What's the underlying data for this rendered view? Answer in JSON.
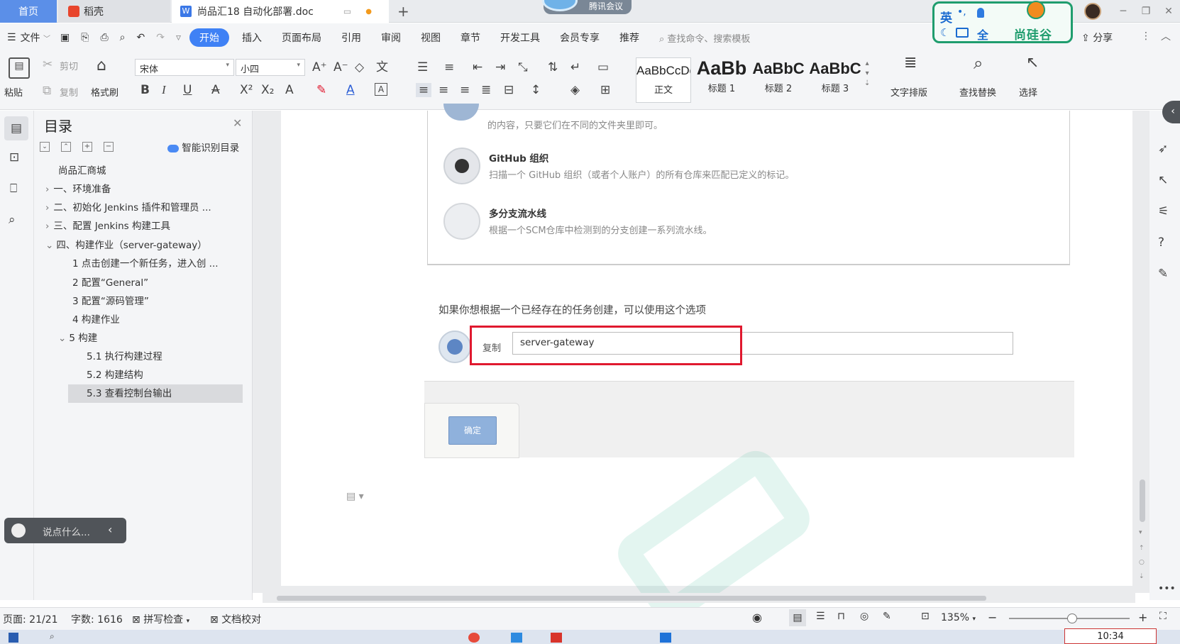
{
  "tabs": {
    "home": "首页",
    "daoke": "稻壳",
    "doc": "尚品汇18 自动化部署.doc",
    "meeting": "腾讯会议"
  },
  "ime": {
    "lang": "英",
    "full": "全",
    "brand": "尚硅谷"
  },
  "menu": {
    "file": "文件",
    "items": [
      "开始",
      "插入",
      "页面布局",
      "引用",
      "审阅",
      "视图",
      "章节",
      "开发工具",
      "会员专享",
      "推荐"
    ],
    "search_placeholder": "查找命令、搜索模板",
    "share": "分享"
  },
  "ribbon": {
    "paste": "粘贴",
    "cut": "剪切",
    "copy": "复制",
    "format_painter": "格式刷",
    "font_name": "宋体",
    "font_size": "小四",
    "styles": [
      {
        "sample": "AaBbCcDd",
        "label": "正文"
      },
      {
        "sample": "AaBb",
        "label": "标题 1"
      },
      {
        "sample": "AaBbC",
        "label": "标题 2"
      },
      {
        "sample": "AaBbC",
        "label": "标题 3"
      }
    ],
    "text_layout": "文字排版",
    "find_replace": "查找替换",
    "select": "选择"
  },
  "toc": {
    "title": "目录",
    "smart": "智能识别目录",
    "items": [
      "尚品汇商城",
      "一、环境准备",
      "二、初始化 Jenkins 插件和管理员 ...",
      "三、配置 Jenkins 构建工具",
      "四、构建作业（server-gateway）",
      "1 点击创建一个新任务，进入创 ...",
      "2 配置“General”",
      "3 配置“源码管理”",
      "4 构建作业",
      "5 构建",
      "5.1 执行构建过程",
      "5.2 构建结构",
      "5.3 查看控制台输出"
    ]
  },
  "chat": {
    "placeholder": "说点什么..."
  },
  "doc": {
    "top_line": "的内容，只要它们在不同的文件夹里即可。",
    "github_title": "GitHub 组织",
    "github_desc": "扫描一个 GitHub 组织（或者个人账户）的所有仓库来匹配已定义的标记。",
    "multibranch_title": "多分支流水线",
    "multibranch_desc": "根据一个SCM仓库中检测到的分支创建一系列流水线。",
    "copy_hint": "如果你想根据一个已经存在的任务创建，可以使用这个选项",
    "copy_label": "复制",
    "copy_value": "server-gateway",
    "ok": "确定",
    "highlight_color": "#e0192f"
  },
  "status": {
    "page": "页面: 21/21",
    "words": "字数: 1616",
    "spell": "拼写检查",
    "proof": "文档校对",
    "zoom": "135%",
    "time": "10:34"
  }
}
